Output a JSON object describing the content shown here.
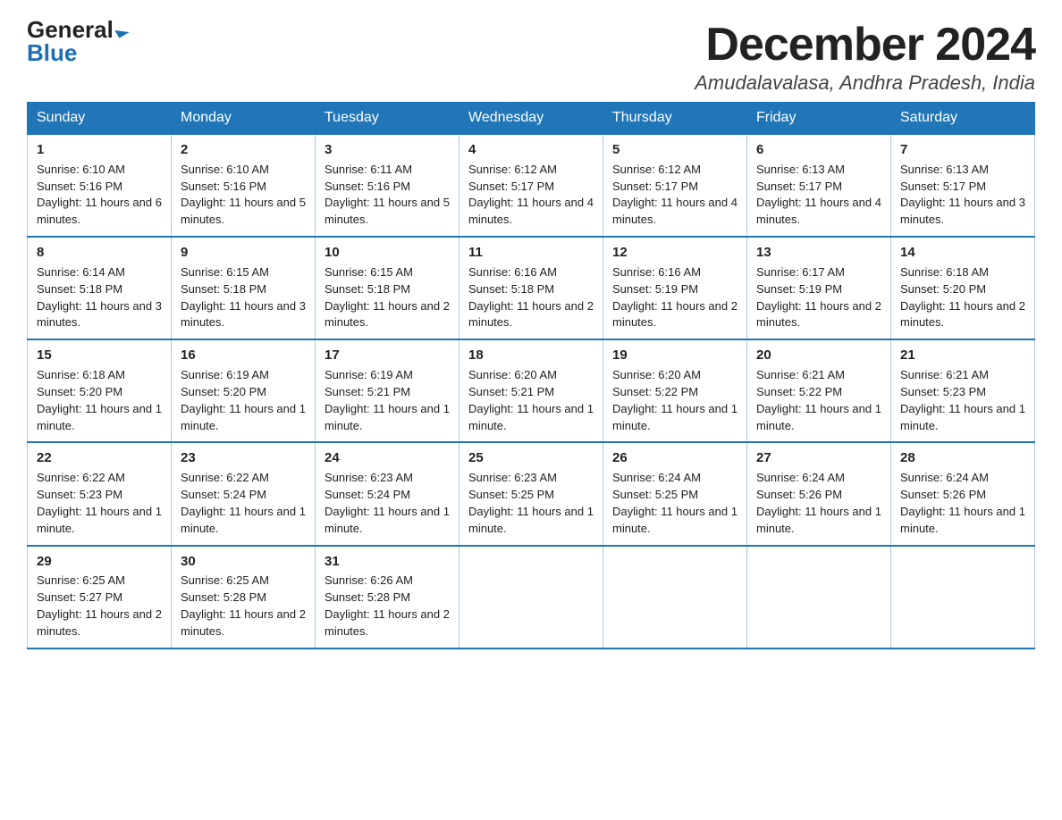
{
  "logo": {
    "general": "General",
    "blue": "Blue"
  },
  "title": {
    "month": "December 2024",
    "location": "Amudalavalasa, Andhra Pradesh, India"
  },
  "headers": [
    "Sunday",
    "Monday",
    "Tuesday",
    "Wednesday",
    "Thursday",
    "Friday",
    "Saturday"
  ],
  "weeks": [
    [
      {
        "day": "1",
        "sunrise": "6:10 AM",
        "sunset": "5:16 PM",
        "daylight": "11 hours and 6 minutes."
      },
      {
        "day": "2",
        "sunrise": "6:10 AM",
        "sunset": "5:16 PM",
        "daylight": "11 hours and 5 minutes."
      },
      {
        "day": "3",
        "sunrise": "6:11 AM",
        "sunset": "5:16 PM",
        "daylight": "11 hours and 5 minutes."
      },
      {
        "day": "4",
        "sunrise": "6:12 AM",
        "sunset": "5:17 PM",
        "daylight": "11 hours and 4 minutes."
      },
      {
        "day": "5",
        "sunrise": "6:12 AM",
        "sunset": "5:17 PM",
        "daylight": "11 hours and 4 minutes."
      },
      {
        "day": "6",
        "sunrise": "6:13 AM",
        "sunset": "5:17 PM",
        "daylight": "11 hours and 4 minutes."
      },
      {
        "day": "7",
        "sunrise": "6:13 AM",
        "sunset": "5:17 PM",
        "daylight": "11 hours and 3 minutes."
      }
    ],
    [
      {
        "day": "8",
        "sunrise": "6:14 AM",
        "sunset": "5:18 PM",
        "daylight": "11 hours and 3 minutes."
      },
      {
        "day": "9",
        "sunrise": "6:15 AM",
        "sunset": "5:18 PM",
        "daylight": "11 hours and 3 minutes."
      },
      {
        "day": "10",
        "sunrise": "6:15 AM",
        "sunset": "5:18 PM",
        "daylight": "11 hours and 2 minutes."
      },
      {
        "day": "11",
        "sunrise": "6:16 AM",
        "sunset": "5:18 PM",
        "daylight": "11 hours and 2 minutes."
      },
      {
        "day": "12",
        "sunrise": "6:16 AM",
        "sunset": "5:19 PM",
        "daylight": "11 hours and 2 minutes."
      },
      {
        "day": "13",
        "sunrise": "6:17 AM",
        "sunset": "5:19 PM",
        "daylight": "11 hours and 2 minutes."
      },
      {
        "day": "14",
        "sunrise": "6:18 AM",
        "sunset": "5:20 PM",
        "daylight": "11 hours and 2 minutes."
      }
    ],
    [
      {
        "day": "15",
        "sunrise": "6:18 AM",
        "sunset": "5:20 PM",
        "daylight": "11 hours and 1 minute."
      },
      {
        "day": "16",
        "sunrise": "6:19 AM",
        "sunset": "5:20 PM",
        "daylight": "11 hours and 1 minute."
      },
      {
        "day": "17",
        "sunrise": "6:19 AM",
        "sunset": "5:21 PM",
        "daylight": "11 hours and 1 minute."
      },
      {
        "day": "18",
        "sunrise": "6:20 AM",
        "sunset": "5:21 PM",
        "daylight": "11 hours and 1 minute."
      },
      {
        "day": "19",
        "sunrise": "6:20 AM",
        "sunset": "5:22 PM",
        "daylight": "11 hours and 1 minute."
      },
      {
        "day": "20",
        "sunrise": "6:21 AM",
        "sunset": "5:22 PM",
        "daylight": "11 hours and 1 minute."
      },
      {
        "day": "21",
        "sunrise": "6:21 AM",
        "sunset": "5:23 PM",
        "daylight": "11 hours and 1 minute."
      }
    ],
    [
      {
        "day": "22",
        "sunrise": "6:22 AM",
        "sunset": "5:23 PM",
        "daylight": "11 hours and 1 minute."
      },
      {
        "day": "23",
        "sunrise": "6:22 AM",
        "sunset": "5:24 PM",
        "daylight": "11 hours and 1 minute."
      },
      {
        "day": "24",
        "sunrise": "6:23 AM",
        "sunset": "5:24 PM",
        "daylight": "11 hours and 1 minute."
      },
      {
        "day": "25",
        "sunrise": "6:23 AM",
        "sunset": "5:25 PM",
        "daylight": "11 hours and 1 minute."
      },
      {
        "day": "26",
        "sunrise": "6:24 AM",
        "sunset": "5:25 PM",
        "daylight": "11 hours and 1 minute."
      },
      {
        "day": "27",
        "sunrise": "6:24 AM",
        "sunset": "5:26 PM",
        "daylight": "11 hours and 1 minute."
      },
      {
        "day": "28",
        "sunrise": "6:24 AM",
        "sunset": "5:26 PM",
        "daylight": "11 hours and 1 minute."
      }
    ],
    [
      {
        "day": "29",
        "sunrise": "6:25 AM",
        "sunset": "5:27 PM",
        "daylight": "11 hours and 2 minutes."
      },
      {
        "day": "30",
        "sunrise": "6:25 AM",
        "sunset": "5:28 PM",
        "daylight": "11 hours and 2 minutes."
      },
      {
        "day": "31",
        "sunrise": "6:26 AM",
        "sunset": "5:28 PM",
        "daylight": "11 hours and 2 minutes."
      },
      null,
      null,
      null,
      null
    ]
  ]
}
